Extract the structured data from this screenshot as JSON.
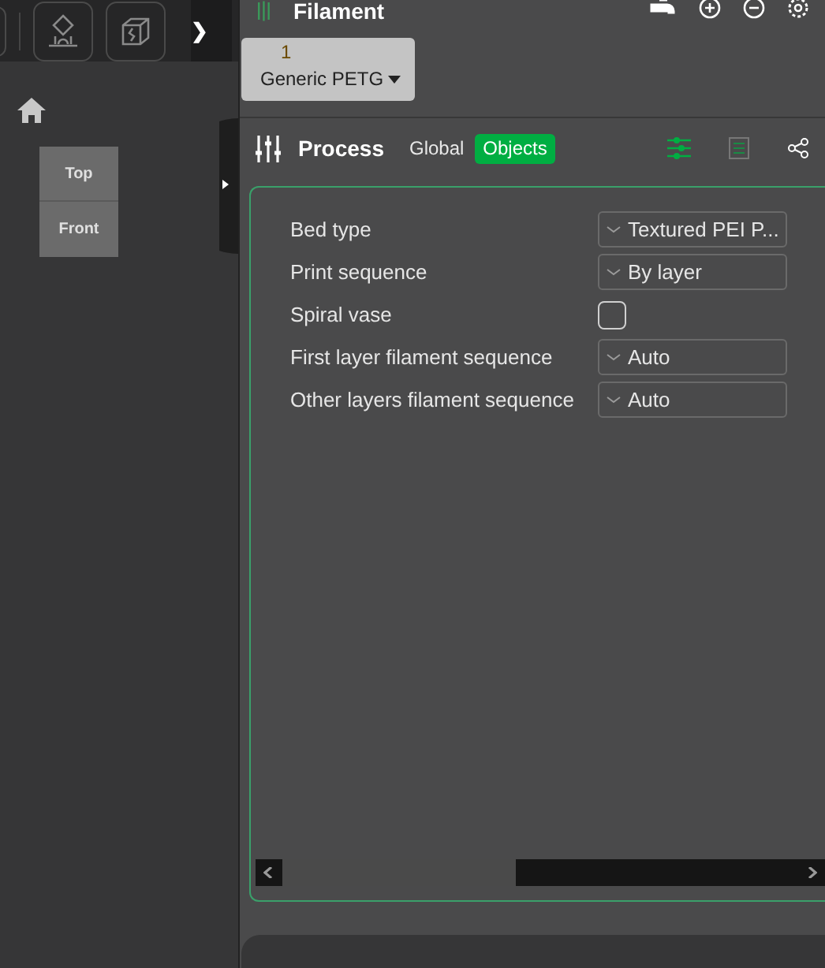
{
  "view_cube": {
    "top": "Top",
    "front": "Front"
  },
  "sidebar_toggle": "❯",
  "filament": {
    "title": "Filament",
    "extruders": [
      {
        "number": "1",
        "name": "Generic PETG"
      }
    ]
  },
  "process": {
    "title": "Process",
    "tabs": [
      {
        "label": "Global",
        "selected": false
      },
      {
        "label": "Objects",
        "selected": true
      }
    ],
    "settings": [
      {
        "kind": "select",
        "label": "Bed type",
        "value": "Textured PEI P..."
      },
      {
        "kind": "select",
        "label": "Print sequence",
        "value": "By layer"
      },
      {
        "kind": "checkbox",
        "label": "Spiral vase",
        "checked": false
      },
      {
        "kind": "select",
        "label": "First layer filament sequence",
        "value": "Auto"
      },
      {
        "kind": "select",
        "label": "Other layers filament sequence",
        "value": "Auto"
      }
    ]
  }
}
